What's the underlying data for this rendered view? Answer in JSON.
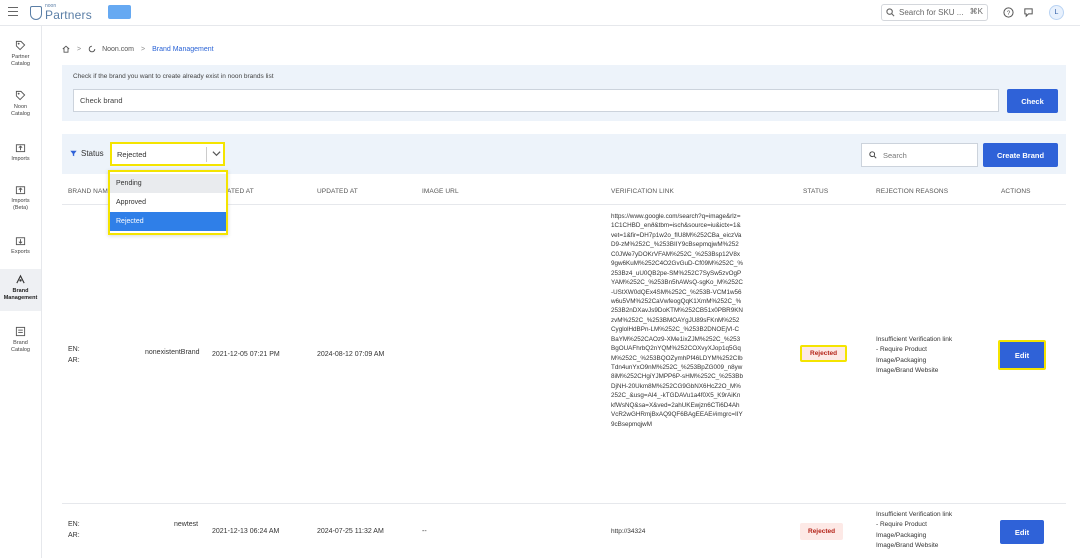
{
  "brand": {
    "small": "noon",
    "name": "Partners"
  },
  "topbar": {
    "search_placeholder": "Search for SKU ...",
    "shortcut": "⌘K",
    "avatar": "L"
  },
  "sidebar": [
    {
      "line1": "Partner",
      "line2": "Catalog",
      "icon": "tag-icon"
    },
    {
      "line1": "Noon",
      "line2": "Catalog",
      "icon": "tag-icon"
    },
    {
      "line1": "Imports",
      "line2": "",
      "icon": "upload-icon"
    },
    {
      "line1": "Imports",
      "line2": "(Beta)",
      "icon": "upload-icon"
    },
    {
      "line1": "Exports",
      "line2": "",
      "icon": "download-icon"
    },
    {
      "line1": "Brand",
      "line2": "Management",
      "icon": "brand-icon",
      "active": true
    },
    {
      "line1": "Brand",
      "line2": "Catalog",
      "icon": "catalog-icon"
    }
  ],
  "breadcrumb": {
    "home": "home",
    "root": "Noon.com",
    "current": "Brand Management"
  },
  "check": {
    "hint": "Check if the brand you want to create already exist in noon brands list",
    "placeholder": "Check brand",
    "button": "Check"
  },
  "filters": {
    "status_label": "Status",
    "status_value": "Rejected",
    "options": [
      "Pending",
      "Approved",
      "Rejected"
    ],
    "search_placeholder": "Search",
    "create_button": "Create Brand"
  },
  "table": {
    "headers": [
      "Brand Nam",
      "ated At",
      "Updated At",
      "Image URL",
      "Verification Link",
      "Status",
      "Rejection Reasons",
      "Actions"
    ],
    "rows": [
      {
        "en_label": "EN:",
        "ar_label": "AR:",
        "en_name": "nonexistentBrand",
        "created": "2021-12-05 07:21 PM",
        "updated": "2024-08-12 07:09 AM",
        "image": "",
        "link": "https://www.google.com/search?q=image&rlz=1C1CHBD_enð&tbm=isch&source=iu&ictx=1&vet=1&fir=DH7p1w2o_fIU8M%252CBa_eiczVaD9-zM%252C_%253BIIY9cBsepmqjwM%252C0JWe7yDOKrVFAM%252C_%253Bsp12V8x9gw6KuM%252C4O2GvGuD-Cf09M%252C_%253Bz4_uU0QB2pe-SM%252C7SySw5zvOgPYAM%252C_%253Bn5hAWsQ-sgKo_M%252C-UStXW0dQEx4SM%252C_%253B-VCM1w56w6u5VM%252CaVwfeogQqK1XmM%252C_%253B2nDXavJs9DoKTM%252CB51x0PBR9KNzvM%252C_%253BMOAYgJU89sFKnM%252CyglolHdBPn-LM%252C_%253B2DNOEjVl-CBaYM%252CAOz9-XMe1ixZJM%252C_%253BgOUAFhrbQ2nYQM%252COXvyXJop1q5GqM%252C_%253BQOZymhPf46LDYM%252CIbTdn4unYxO9nM%252C_%253BpZG009_n8yw8iM%252CHgiYJMPP6P-sHM%252C_%253BbDjNH-20Ukm8M%252CG9GbNX6HcZ2O_M%252C_&usg=AI4_-kTGDAVu1a4f0X5_K9rAiKnkfWsNQ&sa=X&ved=2ahUKEwjzn6CTi6D4AhVcR2wGHRmjBxAQ9QF6BAgEEAE#imgrc=IIY9cBsepmqjwM",
        "status": "Rejected",
        "reasons": [
          "Insufficient Verification link",
          "- Require Product",
          "Image/Packaging",
          "Image/Brand Website"
        ],
        "action": "Edit"
      },
      {
        "en_label": "EN:",
        "ar_label": "AR:",
        "en_name": "newtest",
        "created": "2021-12-13 06:24 AM",
        "updated": "2024-07-25 11:32 AM",
        "image": "--",
        "link": "http://34324",
        "status": "Rejected",
        "reasons": [
          "Insufficient Verification link",
          "- Require Product",
          "Image/Packaging",
          "Image/Brand Website"
        ],
        "action": "Edit"
      }
    ]
  },
  "colors": {
    "primary": "#2f62d8",
    "highlight": "#f4e400",
    "panel": "#edf3fa",
    "rejected_bg": "#fde9e6",
    "rejected_text": "#b42318"
  }
}
